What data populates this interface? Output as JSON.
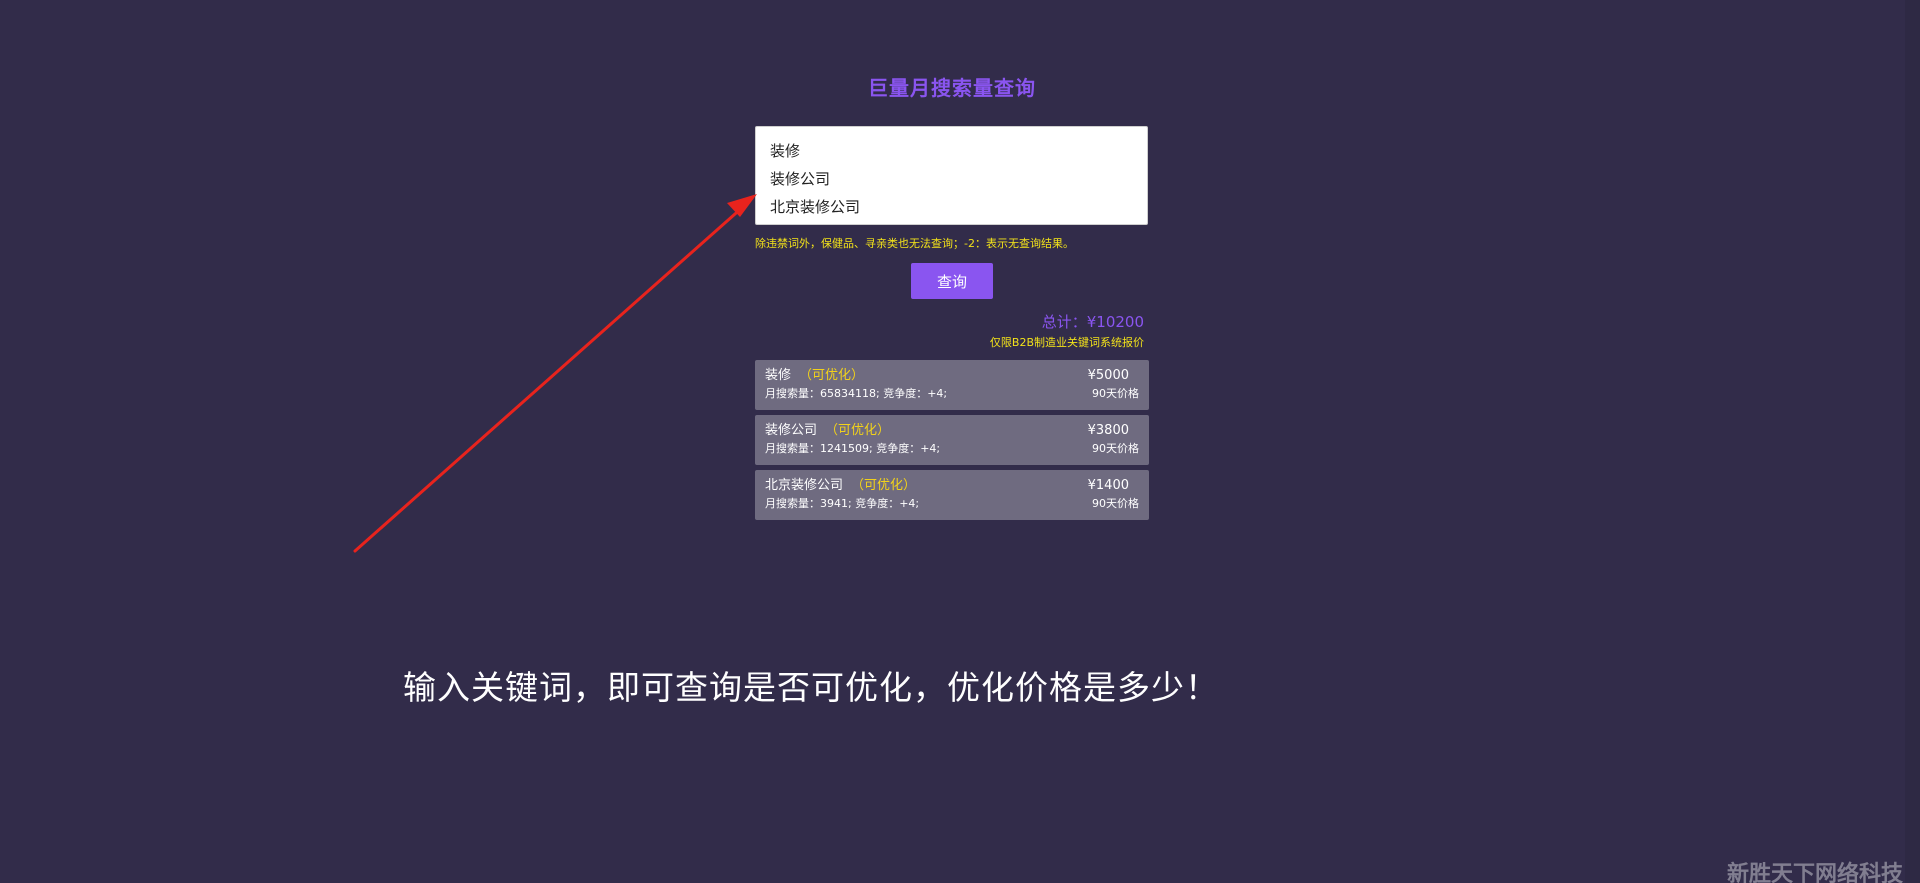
{
  "title": "巨量月搜索量查询",
  "keywords": [
    "装修",
    "装修公司",
    "北京装修公司"
  ],
  "notice": "除违禁词外，保健品、寻亲类也无法查询；-2：表示无查询结果。",
  "query_button": "查询",
  "total": "总计：¥10200",
  "b2b_note": "仅限B2B制造业关键词系统报价",
  "results": [
    {
      "keyword": "装修",
      "status": "（可优化）",
      "stats": "月搜索量：65834118; 竞争度：+4;",
      "price": "¥5000",
      "price_label": "90天价格"
    },
    {
      "keyword": "装修公司",
      "status": "（可优化）",
      "stats": "月搜索量：1241509; 竞争度：+4;",
      "price": "¥3800",
      "price_label": "90天价格"
    },
    {
      "keyword": "北京装修公司",
      "status": "（可优化）",
      "stats": "月搜索量：3941; 竞争度：+4;",
      "price": "¥1400",
      "price_label": "90天价格"
    }
  ],
  "caption": "输入关键词，即可查询是否可优化，优化价格是多少！",
  "watermark": "新胜天下网络科技",
  "colors": {
    "background": "#322c4a",
    "accent": "#8a55f0",
    "highlight": "#f2e21a",
    "arrow": "#e8231d"
  }
}
